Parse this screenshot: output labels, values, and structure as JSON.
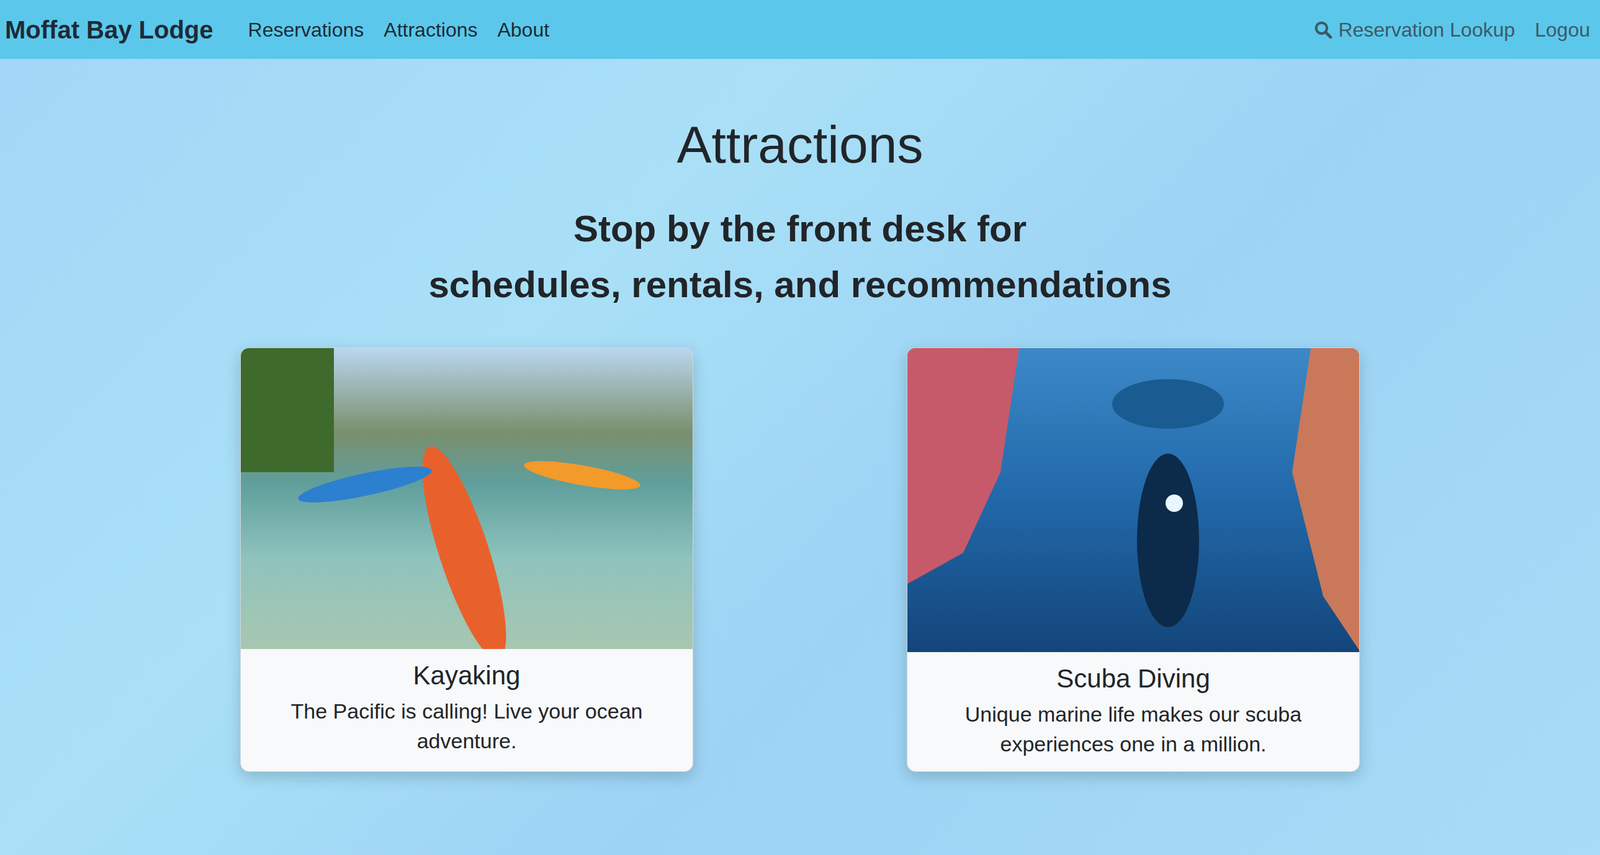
{
  "navbar": {
    "brand": "Moffat Bay Lodge",
    "links": [
      {
        "label": "Reservations"
      },
      {
        "label": "Attractions"
      },
      {
        "label": "About"
      }
    ],
    "right_links": [
      {
        "label": "Reservation Lookup",
        "kind": "search"
      },
      {
        "label": "Logou",
        "kind": "plain"
      }
    ]
  },
  "heading": "Attractions",
  "subtitle": [
    "Stop by the front desk for",
    "schedules, rentals, and recommendations"
  ],
  "cards": [
    {
      "title": "Kayaking",
      "text": "The Pacific is calling! Live your ocean adventure.",
      "kind": "kayak"
    },
    {
      "title": "Scuba Diving",
      "text": "Unique marine life makes our scuba experiences one in a million.",
      "kind": "scuba"
    }
  ]
}
